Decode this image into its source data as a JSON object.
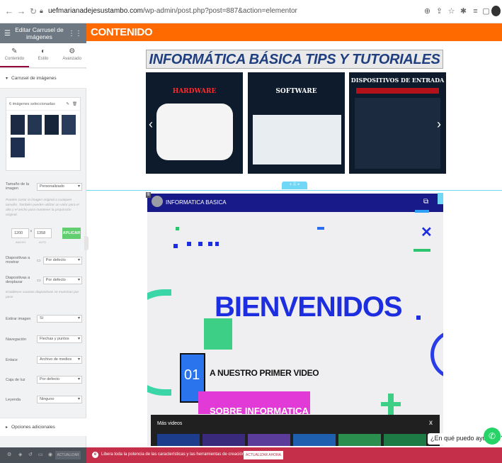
{
  "browser": {
    "url_host": "uefmarianadejesustambo.com",
    "url_path": "/wp-admin/post.php?post=887&action=elementor"
  },
  "panel": {
    "title": "Editar Carrusel de imágenes",
    "tabs": [
      "Contenido",
      "Estilo",
      "Avanzado"
    ],
    "section_title": "Carrusel de imágenes",
    "gallery_label": "6 imágenes seleccionadas",
    "image_size_label": "Tamaño de la imagen",
    "image_size_value": "Personalizado",
    "image_size_hint": "Puedes cortar la imagen original a cualquier tamaño. También puedes utilizar un valor para el alto y el ancho para mantener la proporción original.",
    "width_value": "1200",
    "height_value": "1358",
    "width_caption": "ANCHO",
    "height_caption": "ALTO",
    "apply_button": "APLICAR",
    "slides_show_label": "Diapositivas a mostrar",
    "slides_show_value": "Por defecto",
    "slides_scroll_label": "Diapositivas a desplazar",
    "slides_scroll_value": "Por defecto",
    "slides_scroll_hint": "Establecer cuantas diapositivas se muestran por pase",
    "stretch_label": "Estirar imagen",
    "stretch_value": "Sí",
    "nav_label": "Navegación",
    "nav_value": "Flechas y puntos",
    "link_label": "Enlace",
    "link_value": "Archivo de medios",
    "lightbox_label": "Caja de luz",
    "lightbox_value": "Por defecto",
    "caption_label": "Leyenda",
    "caption_value": "Ninguno",
    "additional_title": "Opciones adicionales"
  },
  "page": {
    "header_title": "CONTENIDO",
    "banner_title": "INFORMÁTICA BÁSICA TIPS Y TUTORIALES",
    "carousel": {
      "cards": [
        {
          "title": "HARDWARE",
          "title_color": "#ff2a2a"
        },
        {
          "title": "SOFTWARE",
          "title_color": "#ffffff"
        },
        {
          "title": "DISPOSITIVOS DE ENTRADA",
          "title_color": "#ffffff"
        }
      ],
      "prev_icon": "‹",
      "next_icon": "›"
    },
    "section_handle": "+ ⠿ ×",
    "video": {
      "channel": "INFORMATICA BASICA",
      "headline": "BIENVENIDOS",
      "number": "01",
      "subtitle": "A NUESTRO PRIMER VIDEO",
      "pink_label": "SOBRE INFORMATICA",
      "more_videos": "Más videos",
      "close": "x"
    },
    "chat_text": "¿En qué puedo ayudarte?"
  },
  "bottom": {
    "update_button": "ACTUALIZAR",
    "promo_text": "Libera toda la potencia de las características y las herramientas de creación web de Elementor.",
    "promo_button": "ACTUALIZAR AHORA"
  },
  "colors": {
    "accent_orange": "#ff6a00",
    "elementor_maroon": "#93003c",
    "promo_bar": "#c62f49",
    "apply_green": "#61ce70",
    "video_blue": "#1d2de0"
  }
}
